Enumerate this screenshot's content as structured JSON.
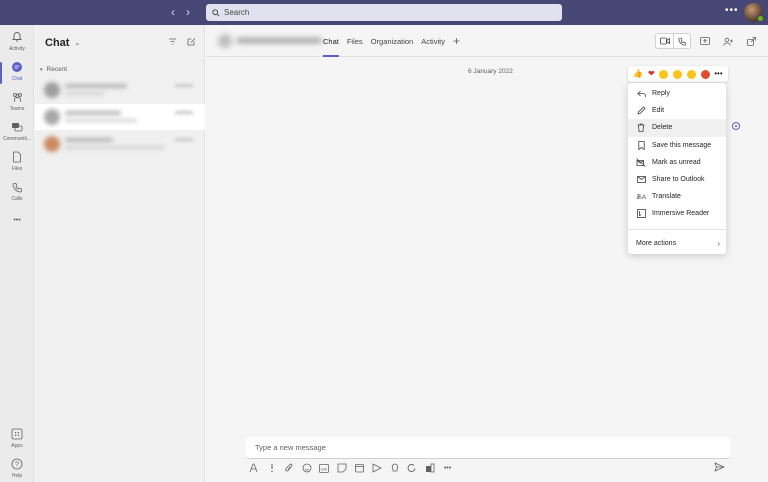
{
  "titlebar": {
    "back_glyph": "‹",
    "forward_glyph": "›",
    "search_placeholder": "Search",
    "more_glyph": "•••"
  },
  "rail": [
    {
      "label": "Activity",
      "icon": "bell-icon"
    },
    {
      "label": "Chat",
      "icon": "chat-icon",
      "active": true
    },
    {
      "label": "Teams",
      "icon": "teams-icon"
    },
    {
      "label": "Communiti...",
      "icon": "communities-icon"
    },
    {
      "label": "Files",
      "icon": "file-icon"
    },
    {
      "label": "Calls",
      "icon": "phone-icon"
    },
    {
      "label": "",
      "icon": "more-apps-icon",
      "glyph": "•••"
    },
    {
      "label": "Apps",
      "icon": "apps-icon"
    },
    {
      "label": "Help",
      "icon": "help-icon"
    }
  ],
  "chatlist": {
    "title": "Chat",
    "section": "Recent"
  },
  "header": {
    "tabs": [
      "Chat",
      "Files",
      "Organization",
      "Activity"
    ],
    "active_tab": "Chat",
    "add_tab_glyph": "+"
  },
  "conversation": {
    "date": "6 January 2022"
  },
  "reactions": [
    "like",
    "heart",
    "laugh",
    "surprised",
    "sad",
    "angry"
  ],
  "menu": {
    "items": [
      {
        "label": "Reply",
        "icon": "reply-icon"
      },
      {
        "label": "Edit",
        "icon": "pencil-icon"
      },
      {
        "label": "Delete",
        "icon": "trash-icon",
        "hover": true
      },
      {
        "label": "Save this message",
        "icon": "bookmark-icon"
      },
      {
        "label": "Mark as unread",
        "icon": "unread-icon"
      },
      {
        "label": "Share to Outlook",
        "icon": "mail-icon"
      },
      {
        "label": "Translate",
        "icon": "translate-icon"
      },
      {
        "label": "Immersive Reader",
        "icon": "immersive-reader-icon"
      }
    ],
    "more_actions": "More actions"
  },
  "compose": {
    "placeholder": "Type a new message"
  },
  "colors": {
    "titlebar": "#464775",
    "accent": "#5b5fc7",
    "presence": "#6bb700"
  }
}
